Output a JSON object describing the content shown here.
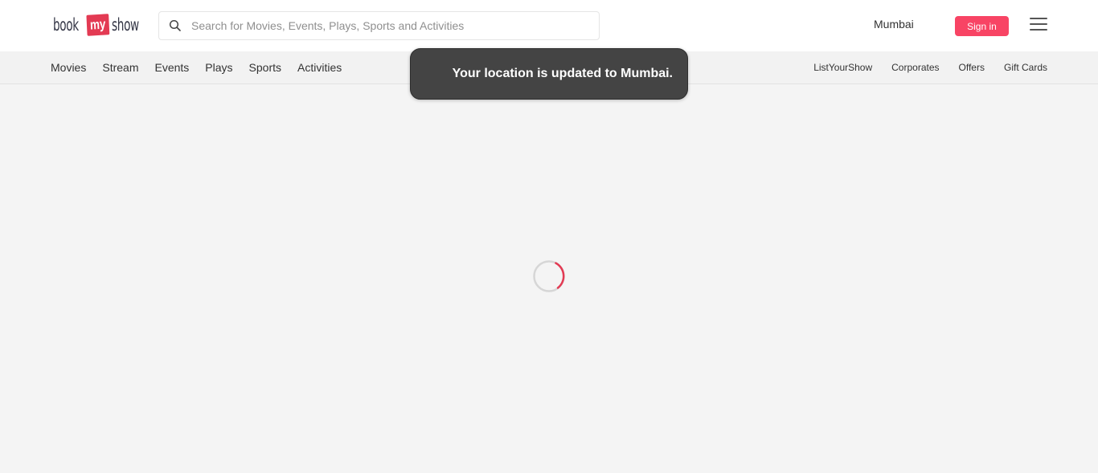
{
  "header": {
    "logo": {
      "part1": "book",
      "part2": "my",
      "part3": "show"
    },
    "search": {
      "placeholder": "Search for Movies, Events, Plays, Sports and Activities",
      "value": ""
    },
    "city": "Mumbai",
    "signin_label": "Sign in"
  },
  "subnav": {
    "left_items": [
      "Movies",
      "Stream",
      "Events",
      "Plays",
      "Sports",
      "Activities"
    ],
    "right_items": [
      "ListYourShow",
      "Corporates",
      "Offers",
      "Gift Cards"
    ]
  },
  "toast": {
    "message": "Your location is updated to Mumbai."
  },
  "colors": {
    "brand": "#f84464",
    "logo_red": "#e33a53",
    "toast_bg": "#444444",
    "page_bg": "#f4f4f4"
  },
  "icons": {
    "search": "search-icon",
    "menu": "hamburger-menu-icon",
    "loading": "loading-spinner-icon"
  }
}
